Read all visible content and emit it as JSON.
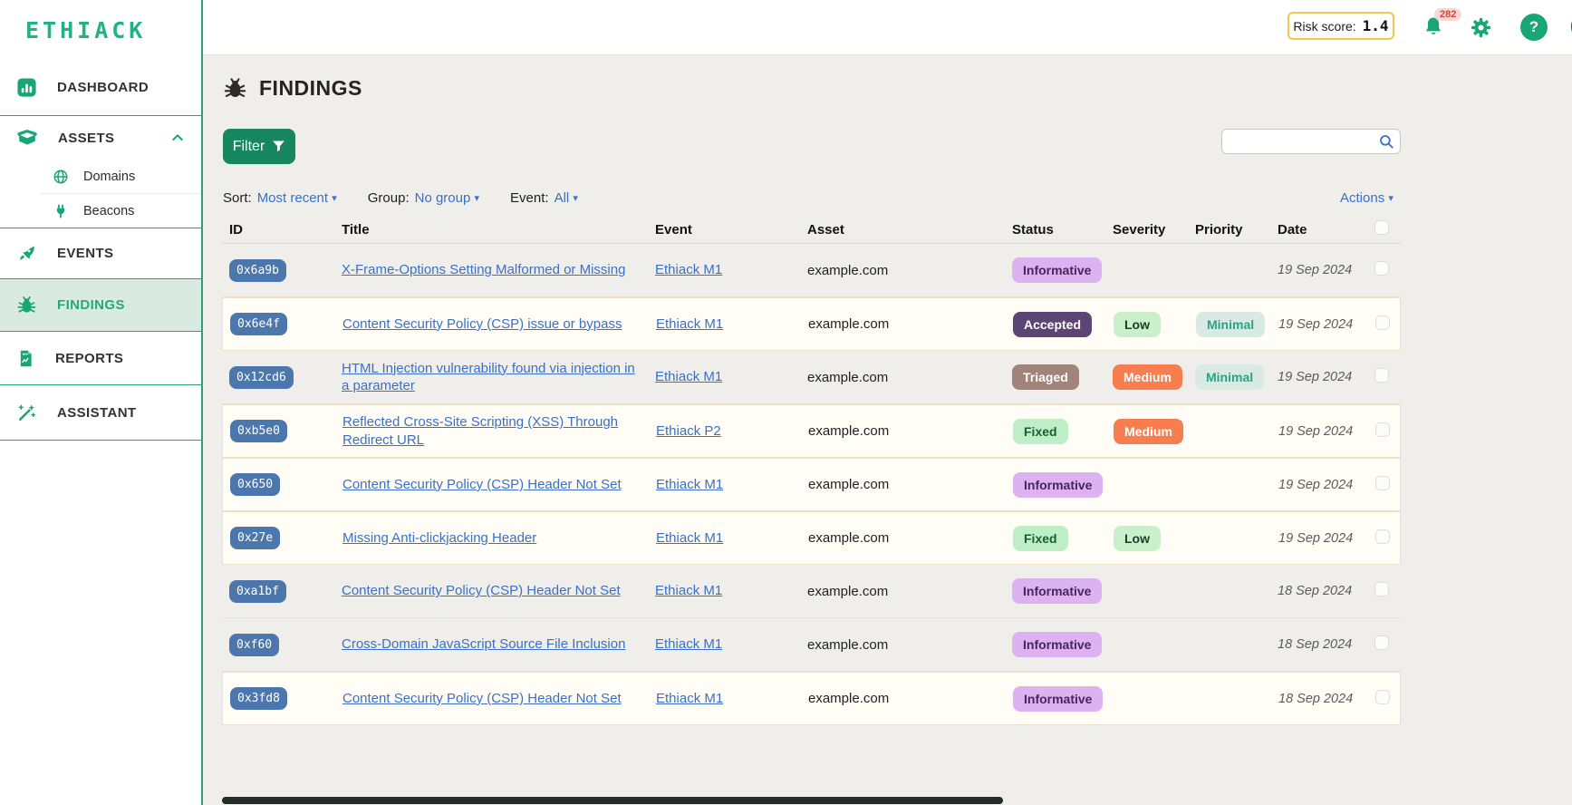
{
  "brand": {
    "logo": "ETHIACK",
    "accent_green": "#18a674",
    "link_blue": "#3a70c6",
    "risk_border_yellow": "#f0c84a"
  },
  "topbar": {
    "risk_label": "Risk score:",
    "risk_value": "1.4",
    "notification_count": "282",
    "help_glyph": "?"
  },
  "sidebar": {
    "dashboard": "DASHBOARD",
    "assets": "ASSETS",
    "domains": "Domains",
    "beacons": "Beacons",
    "events": "EVENTS",
    "findings": "FINDINGS",
    "reports": "REPORTS",
    "assistant": "ASSISTANT"
  },
  "header": {
    "title": "FINDINGS"
  },
  "toolbar": {
    "filter_label": "Filter",
    "sort_label": "Sort:",
    "sort_value": "Most recent",
    "group_label": "Group:",
    "group_value": "No group",
    "event_label": "Event:",
    "event_value": "All",
    "actions_label": "Actions",
    "caret": "▾",
    "search_placeholder": ""
  },
  "table": {
    "columns": [
      "ID",
      "Title",
      "Event",
      "Asset",
      "Status",
      "Severity",
      "Priority",
      "Date"
    ],
    "rows": [
      {
        "id": "0x6a9b",
        "title": "X-Frame-Options Setting Malformed or Missing",
        "event": "Ethiack M1",
        "asset": "example.com",
        "status": "Informative",
        "severity": null,
        "priority": null,
        "date": "19 Sep 2024",
        "highlight": "gray"
      },
      {
        "id": "0x6e4f",
        "title": "Content Security Policy (CSP) issue or bypass",
        "event": "Ethiack M1",
        "asset": "example.com",
        "status": "Accepted",
        "severity": "Low",
        "priority": "Minimal",
        "date": "19 Sep 2024",
        "highlight": "white"
      },
      {
        "id": "0x12cd6",
        "title": "HTML Injection vulnerability found via injection in a parameter",
        "event": "Ethiack M1",
        "asset": "example.com",
        "status": "Triaged",
        "severity": "Medium",
        "priority": "Minimal",
        "date": "19 Sep 2024",
        "highlight": "gray"
      },
      {
        "id": "0xb5e0",
        "title": "Reflected Cross-Site Scripting (XSS) Through Redirect URL",
        "event": "Ethiack P2",
        "asset": "example.com",
        "status": "Fixed",
        "severity": "Medium",
        "priority": null,
        "date": "19 Sep 2024",
        "highlight": "white"
      },
      {
        "id": "0x650",
        "title": "Content Security Policy (CSP) Header Not Set",
        "event": "Ethiack M1",
        "asset": "example.com",
        "status": "Informative",
        "severity": null,
        "priority": null,
        "date": "19 Sep 2024",
        "highlight": "white"
      },
      {
        "id": "0x27e",
        "title": "Missing Anti-clickjacking Header",
        "event": "Ethiack M1",
        "asset": "example.com",
        "status": "Fixed",
        "severity": "Low",
        "priority": null,
        "date": "19 Sep 2024",
        "highlight": "white"
      },
      {
        "id": "0xa1bf",
        "title": "Content Security Policy (CSP) Header Not Set",
        "event": "Ethiack M1",
        "asset": "example.com",
        "status": "Informative",
        "severity": null,
        "priority": null,
        "date": "18 Sep 2024",
        "highlight": "gray"
      },
      {
        "id": "0xf60",
        "title": "Cross-Domain JavaScript Source File Inclusion",
        "event": "Ethiack M1",
        "asset": "example.com",
        "status": "Informative",
        "severity": null,
        "priority": null,
        "date": "18 Sep 2024",
        "highlight": "gray"
      },
      {
        "id": "0x3fd8",
        "title": "Content Security Policy (CSP) Header Not Set",
        "event": "Ethiack M1",
        "asset": "example.com",
        "status": "Informative",
        "severity": null,
        "priority": null,
        "date": "18 Sep 2024",
        "highlight": "white"
      }
    ]
  }
}
